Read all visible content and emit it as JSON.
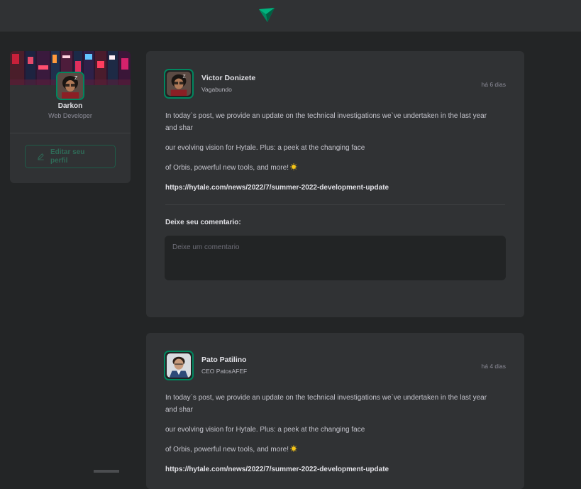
{
  "header": {
    "logo_icon": "paper-plane-logo",
    "accent": "#00b37e"
  },
  "profile": {
    "name": "Darkon",
    "role": "Web Developer",
    "edit_button_label": "Editar seu perfil",
    "edit_icon": "pencil-icon"
  },
  "posts": [
    {
      "author": "Victor Donizete",
      "role": "Vagabundo",
      "time": "há 6 dias",
      "paragraphs": [
        "In today`s post, we provide an update on the technical investigations we`ve undertaken in the last year and shar",
        "our evolving vision for Hytale. Plus: a peek at the changing face",
        "of Orbis, powerful new tools, and more!"
      ],
      "link": "https://hytale.com/news/2022/7/summer-2022-development-update",
      "comment_label": "Deixe seu comentario:",
      "comment_placeholder": "Deixe um comentario"
    },
    {
      "author": "Pato Patilino",
      "role": "CEO PatosAFEF",
      "time": "há 4 dias",
      "paragraphs": [
        "In today`s post, we provide an update on the technical investigations we`ve undertaken in the last year and shar",
        "our evolving vision for Hytale. Plus: a peek at the changing face",
        "of Orbis, powerful new tools, and more!"
      ],
      "link": "https://hytale.com/news/2022/7/summer-2022-development-update"
    }
  ]
}
